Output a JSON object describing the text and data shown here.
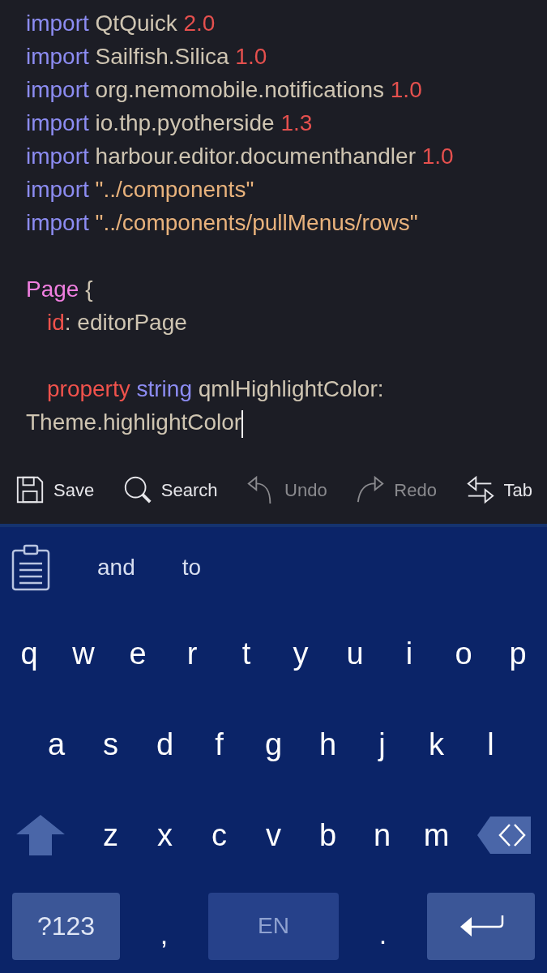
{
  "editor": {
    "lines": [
      {
        "kind": "code",
        "tokens": [
          {
            "kind": "keyword",
            "text": "import"
          },
          {
            "kind": "module",
            "text": "QtQuick"
          },
          {
            "kind": "number",
            "text": "2.0"
          }
        ]
      },
      {
        "kind": "code",
        "tokens": [
          {
            "kind": "keyword",
            "text": "import"
          },
          {
            "kind": "module",
            "text": "Sailfish.Silica"
          },
          {
            "kind": "number",
            "text": "1.0"
          }
        ]
      },
      {
        "kind": "code",
        "tokens": [
          {
            "kind": "keyword",
            "text": "import"
          },
          {
            "kind": "module",
            "text": "org.nemomobile.notifications"
          },
          {
            "kind": "number",
            "text": "1.0"
          }
        ]
      },
      {
        "kind": "code",
        "tokens": [
          {
            "kind": "keyword",
            "text": "import"
          },
          {
            "kind": "module",
            "text": "io.thp.pyotherside"
          },
          {
            "kind": "number",
            "text": "1.3"
          }
        ]
      },
      {
        "kind": "code",
        "tokens": [
          {
            "kind": "keyword",
            "text": "import"
          },
          {
            "kind": "module",
            "text": "harbour.editor.documenthandler"
          },
          {
            "kind": "number",
            "text": "1.0"
          }
        ]
      },
      {
        "kind": "code",
        "tokens": [
          {
            "kind": "keyword",
            "text": "import"
          },
          {
            "kind": "string",
            "text": "\"../components\""
          }
        ]
      },
      {
        "kind": "code",
        "tokens": [
          {
            "kind": "keyword",
            "text": "import"
          },
          {
            "kind": "string",
            "text": "\"../components/pullMenus/rows\""
          }
        ]
      },
      {
        "kind": "blank"
      },
      {
        "kind": "code",
        "tokens": [
          {
            "kind": "type",
            "text": "Page"
          },
          {
            "kind": "plain",
            "text": "{"
          }
        ],
        "children": [
          {
            "kind": "code",
            "tokens": [
              {
                "kind": "property",
                "text": "id"
              },
              {
                "kind": "punct",
                "text": ":"
              },
              {
                "kind": "plain",
                "text": "editorPage"
              }
            ]
          },
          {
            "kind": "blank"
          },
          {
            "kind": "code",
            "tokens": [
              {
                "kind": "property",
                "text": "property"
              },
              {
                "kind": "keyword",
                "text": "string"
              },
              {
                "kind": "plain",
                "text": "qmlHighlightColor:"
              },
              {
                "kind": "plain",
                "text": "Theme.highlightColor"
              },
              {
                "kind": "cursor"
              }
            ]
          }
        ]
      }
    ]
  },
  "toolbar": [
    {
      "kind": "save",
      "label": "Save",
      "disabled": false
    },
    {
      "kind": "search",
      "label": "Search",
      "disabled": false
    },
    {
      "kind": "undo",
      "label": "Undo",
      "disabled": true
    },
    {
      "kind": "redo",
      "label": "Redo",
      "disabled": true
    },
    {
      "kind": "tab",
      "label": "Tab",
      "disabled": false
    }
  ],
  "keyboard": {
    "suggestions": [
      "and",
      "to"
    ],
    "rows": [
      [
        "q",
        "w",
        "e",
        "r",
        "t",
        "y",
        "u",
        "i",
        "o",
        "p"
      ],
      [
        "a",
        "s",
        "d",
        "f",
        "g",
        "h",
        "j",
        "k",
        "l"
      ],
      [
        "z",
        "x",
        "c",
        "v",
        "b",
        "n",
        "m"
      ]
    ],
    "bottom": [
      {
        "kind": "symbols",
        "label": "?123"
      },
      {
        "kind": "char",
        "label": ","
      },
      {
        "kind": "language",
        "label": "EN"
      },
      {
        "kind": "char",
        "label": "."
      },
      {
        "kind": "enter"
      }
    ]
  }
}
